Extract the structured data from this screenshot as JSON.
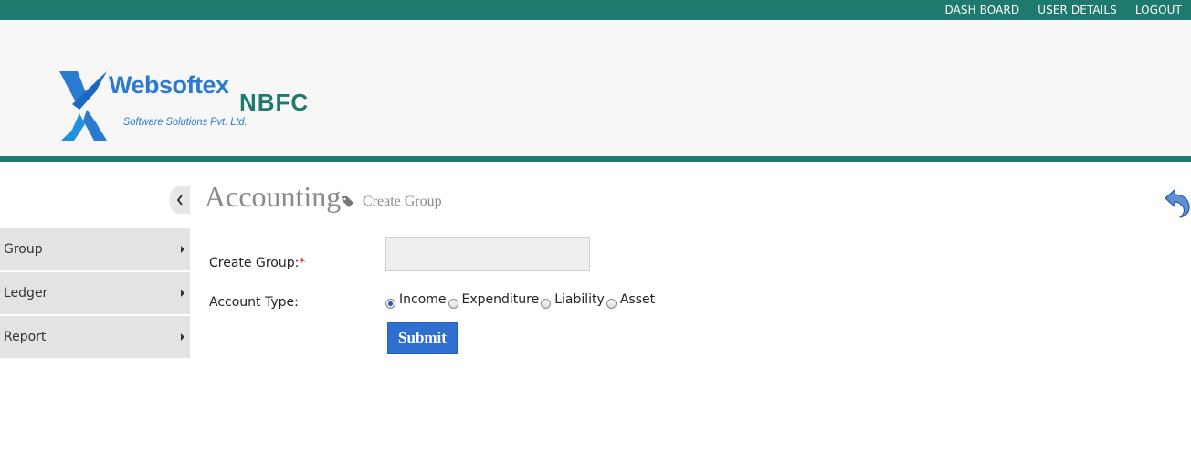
{
  "top_nav": {
    "items": [
      "DASH BOARD",
      "USER DETAILS",
      "LOGOUT"
    ]
  },
  "brand": {
    "name": "Websoftex",
    "product": "NBFC",
    "tagline": "Software Solutions Pvt. Ltd.",
    "primary_color": "#1e7a6e",
    "logo_color": "#2a7bd0"
  },
  "page": {
    "title": "Accounting",
    "breadcrumb": "Create Group",
    "breadcrumb_icon": "tag-icon",
    "back_icon": "undo-arrow-icon",
    "collapse_icon": "chevron-left-icon"
  },
  "sidebar": {
    "items": [
      {
        "label": "Group"
      },
      {
        "label": "Ledger"
      },
      {
        "label": "Report"
      }
    ]
  },
  "form": {
    "group_label": "Create Group:",
    "required_mark": "*",
    "group_value": "",
    "account_type_label": "Account Type:",
    "account_types": [
      "Income",
      "Expenditure",
      "Liability",
      "Asset"
    ],
    "selected_account_type": "Income",
    "submit_label": "Submit",
    "submit_color": "#2f6fd0"
  }
}
